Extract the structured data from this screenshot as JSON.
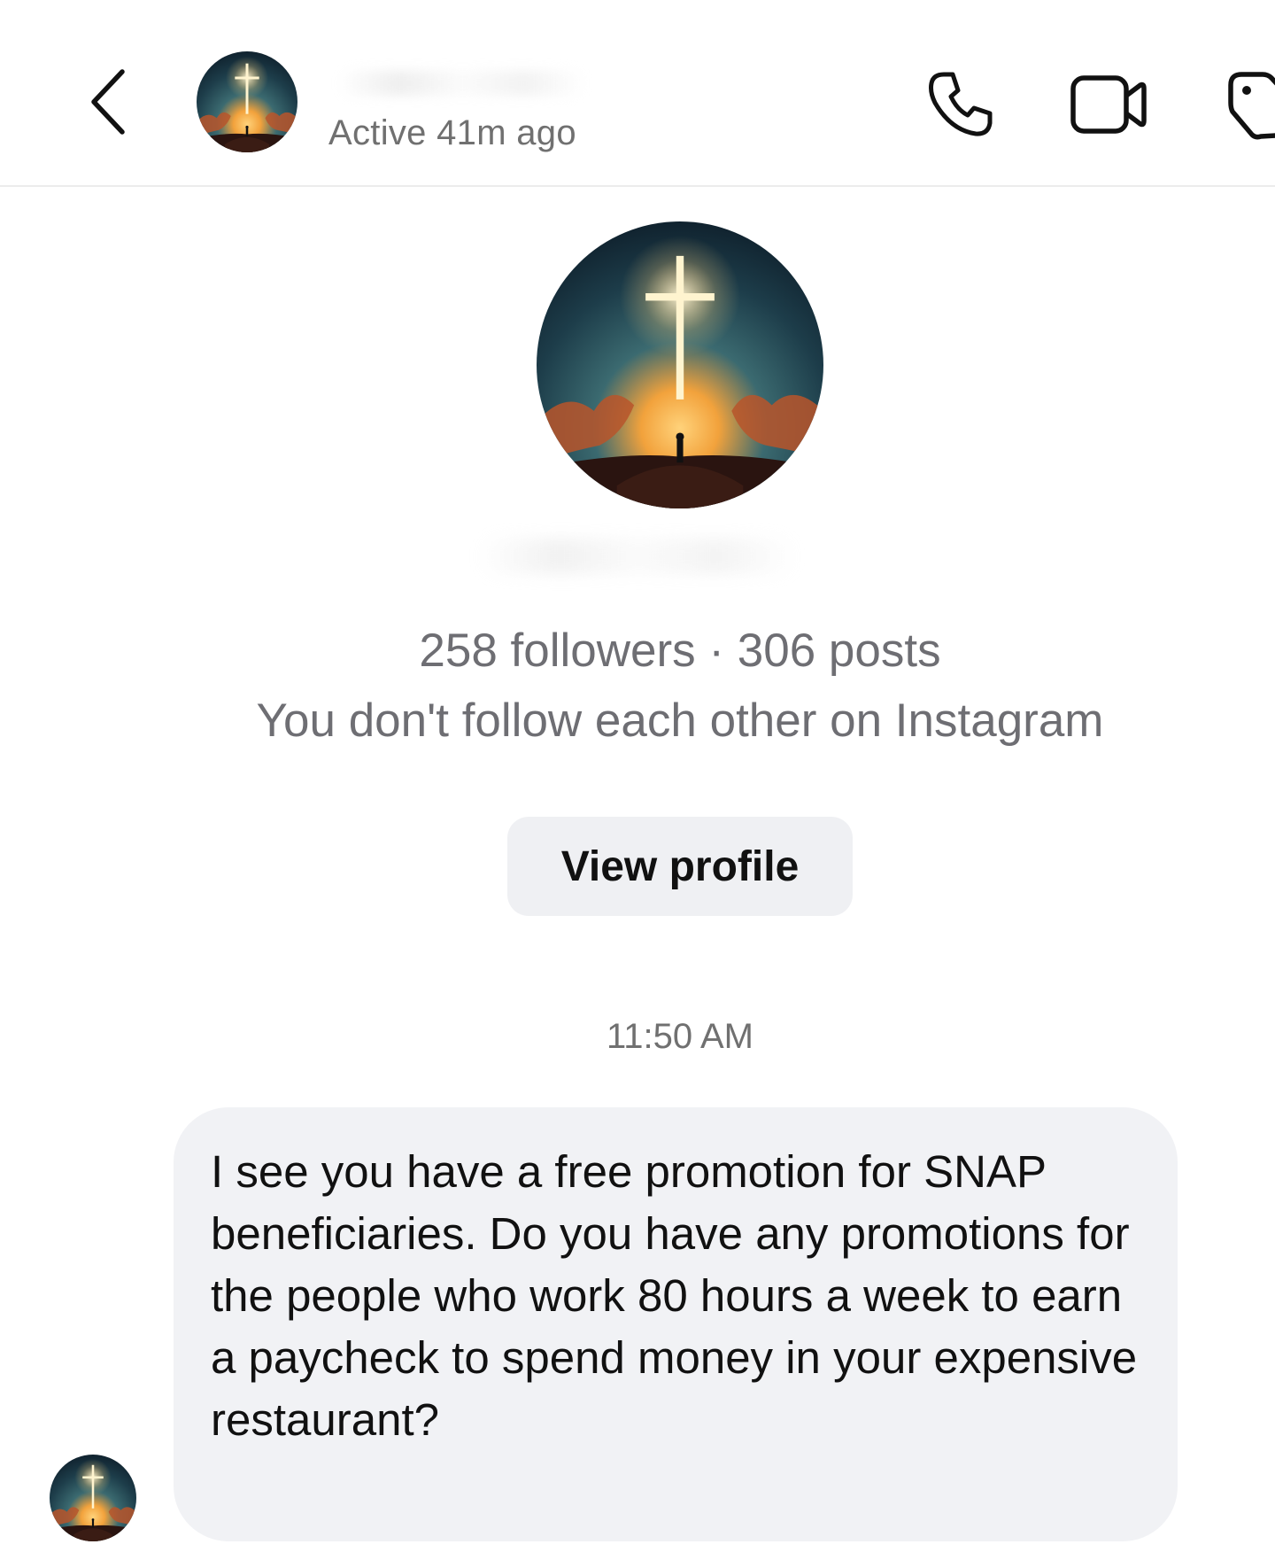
{
  "header": {
    "back_icon": "chevron-left-icon",
    "status": "Active 41m ago",
    "actions": [
      {
        "name": "call",
        "icon": "phone-icon"
      },
      {
        "name": "video",
        "icon": "video-camera-icon"
      },
      {
        "name": "tag",
        "icon": "tag-icon"
      }
    ]
  },
  "profile": {
    "stats": "258 followers · 306 posts",
    "follow_status": "You don't follow each other on Instagram",
    "view_profile_label": "View profile"
  },
  "chat": {
    "timestamp": "11:50 AM",
    "messages": [
      {
        "text": "I see you have a free promotion for SNAP beneficiaries. Do you have any promotions for the people who work 80 hours a week to earn a paycheck to spend money in your expensive restaurant?"
      }
    ]
  },
  "colors": {
    "bubble_bg": "#f1f2f5",
    "button_bg": "#eff0f3",
    "secondary_text": "#6e6e73"
  }
}
